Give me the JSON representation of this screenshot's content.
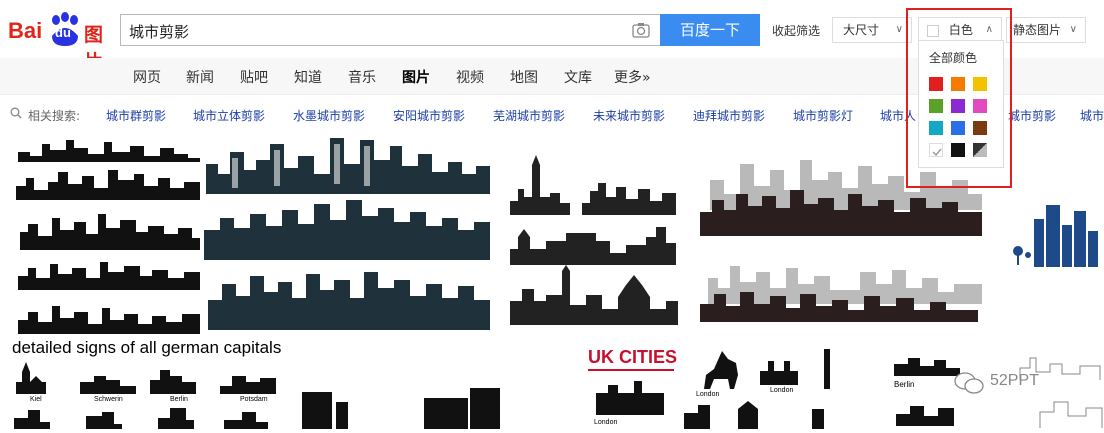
{
  "logo": {
    "text_bai": "Bai",
    "text_du": "du",
    "text_tu": "图片"
  },
  "search": {
    "query": "城市剪影",
    "button": "百度一下"
  },
  "filters": {
    "collapse": "收起筛选",
    "size": "大尺寸",
    "color": "白色",
    "type": "静态图片"
  },
  "color_panel": {
    "title": "全部颜色",
    "swatches": [
      "#e0201c",
      "#f57c00",
      "#f2c200",
      "#5aa12a",
      "#8a2ad2",
      "#e24bc0",
      "#13a9c6",
      "#2b6fe6",
      "#7a3a12",
      "#ffffff",
      "#111111",
      "#777777"
    ]
  },
  "nav": {
    "items": [
      "网页",
      "新闻",
      "贴吧",
      "知道",
      "音乐",
      "图片",
      "视频",
      "地图",
      "文库",
      "更多»"
    ],
    "active": "图片"
  },
  "related": {
    "label": "相关搜索:",
    "items": [
      "城市群剪影",
      "城市立体剪影",
      "水墨城市剪影",
      "安阳城市剪影",
      "芜湖城市剪影",
      "未来城市剪影",
      "迪拜城市剪影",
      "城市剪影灯",
      "城市人",
      "城市剪影",
      "城市"
    ]
  },
  "results": {
    "caption_german": "detailed signs of all german capitals",
    "uk_title": "UK CITIES",
    "german_cities": [
      "Kiel",
      "Schwerin",
      "Berlin",
      "Potsdam"
    ],
    "uk_cities": [
      "London",
      "London",
      "London"
    ],
    "berlin_label": "Berlin",
    "watermark": "52PPT"
  },
  "colors": {
    "accent": "#3b8cf0",
    "link": "#1a3ea8",
    "highlight": "#e02020",
    "dark_skyline": "#1f323b"
  }
}
